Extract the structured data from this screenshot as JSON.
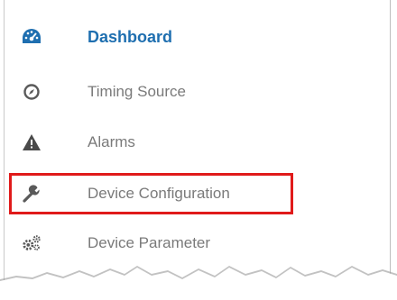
{
  "sidebar": {
    "items": [
      {
        "label": "Dashboard",
        "icon": "dashboard-gauge-icon",
        "active": true
      },
      {
        "label": "Timing Source",
        "icon": "compass-icon",
        "active": false
      },
      {
        "label": "Alarms",
        "icon": "warning-triangle-icon",
        "active": false
      },
      {
        "label": "Device Configuration",
        "icon": "wrench-icon",
        "active": false,
        "highlighted": true
      },
      {
        "label": "Device Parameter",
        "icon": "gears-icon",
        "active": false
      }
    ]
  },
  "colors": {
    "active": "#1f6fb0",
    "inactive_text": "#7a7a7a",
    "icon": "#5a5a5a",
    "highlight": "#e01a1a"
  }
}
